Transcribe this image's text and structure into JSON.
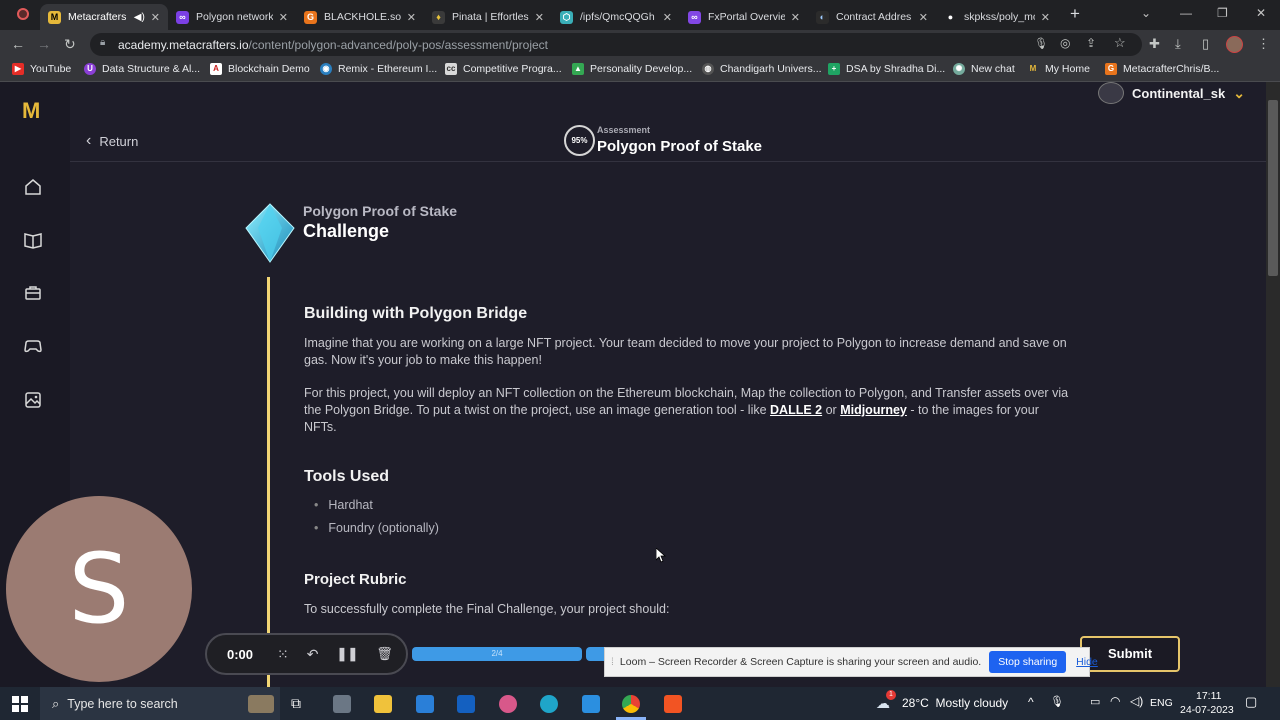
{
  "browser": {
    "tabs": [
      {
        "title": "Metacrafters",
        "active": true
      },
      {
        "title": "Polygon network",
        "active": false
      },
      {
        "title": "BLACKHOLE.sol",
        "active": false
      },
      {
        "title": "Pinata | Effortles",
        "active": false
      },
      {
        "title": "/ipfs/QmcQQGh",
        "active": false
      },
      {
        "title": "FxPortal Overvie",
        "active": false
      },
      {
        "title": "Contract Addres",
        "active": false
      },
      {
        "title": "skpkss/poly_mo",
        "active": false
      }
    ],
    "url_domain": "academy.metacrafters.io",
    "url_path": "/content/polygon-advanced/poly-pos/assessment/project",
    "bookmarks": [
      "YouTube",
      "Data Structure & Al...",
      "Blockchain Demo",
      "Remix - Ethereum I...",
      "Competitive Progra...",
      "Personality Develop...",
      "Chandigarh Univers...",
      "DSA by Shradha Di...",
      "New chat",
      "My Home",
      "MetacrafterChris/B..."
    ]
  },
  "app": {
    "logo": "M",
    "username": "Continental_sk",
    "return_label": "Return",
    "progress_badge": "95%",
    "header_kicker": "Assessment",
    "header_title": "Polygon Proof of Stake",
    "challenge_subtitle": "Polygon Proof of Stake",
    "challenge_title": "Challenge",
    "section1_heading": "Building with Polygon Bridge",
    "para1": "Imagine that you are working on a large NFT project. Your team decided to move your project to Polygon to increase demand and save on gas. Now it's your job to make this happen!",
    "para2_before": "For this project, you will deploy an NFT collection on the Ethereum blockchain, Map the collection to Polygon, and Transfer assets over via the Polygon Bridge. To put a twist on the project, use an image generation tool - like ",
    "link1": "DALLE 2",
    "para2_mid": " or ",
    "link2": "Midjourney",
    "para2_after": " - to the images for your NFTs.",
    "tools_heading": "Tools Used",
    "tools": [
      "Hardhat",
      "Foundry (optionally)"
    ],
    "rubric_heading": "Project Rubric",
    "rubric_text": "To successfully complete the Final Challenge, your project should:",
    "step_progress": "2/4",
    "submit_label": "Submit"
  },
  "recorder": {
    "avatar_letter": "S",
    "time": "0:00"
  },
  "loom": {
    "message": "Loom – Screen Recorder & Screen Capture is sharing your screen and audio.",
    "stop_label": "Stop sharing",
    "hide_label": "Hide"
  },
  "taskbar": {
    "search_placeholder": "Type here to search",
    "weather": "28°C  Mostly cloudy",
    "weather_badge": "1",
    "lang": "ENG",
    "time": "17:11",
    "date": "24-07-2023"
  },
  "colors": {
    "accent_gold": "#f2d675",
    "progress_blue": "#3e9ae6",
    "loom_button": "#1e63f0",
    "app_bg": "#1e1d29"
  }
}
